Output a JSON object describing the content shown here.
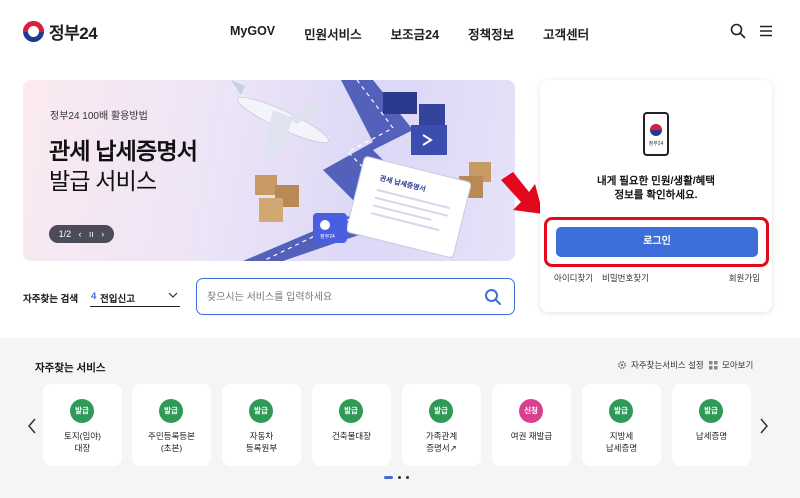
{
  "header": {
    "logo_text": "정부24",
    "nav": [
      "MyGOV",
      "민원서비스",
      "보조금24",
      "정책정보",
      "고객센터"
    ]
  },
  "banner": {
    "subtitle": "정부24 100배 활용방법",
    "title_line1": "관세 납세증명서",
    "title_line2": "발급 서비스",
    "page_indicator": "1/2",
    "prev_symbol": "‹",
    "pause_symbol": "ıı",
    "next_symbol": "›",
    "document_label": "관세 납세증명서",
    "badge_label": "정부24"
  },
  "login": {
    "phone_label": "정부24",
    "message_line1": "내게 필요한 민원/생활/혜택",
    "message_line2": "정보를 확인하세요.",
    "button_label": "로그인",
    "find_id": "아이디찾기",
    "find_password": "비밀번호찾기",
    "signup": "회원가입"
  },
  "search": {
    "fav_label": "자주찾는 검색",
    "fav_number": "4",
    "fav_value": "전입신고",
    "placeholder": "찾으시는 서비스를 입력하세요"
  },
  "services": {
    "title": "자주찾는 서비스",
    "settings_label": "자주찾는서비스 설정",
    "view_all_label": "모아보기",
    "items": [
      {
        "badge": "발급",
        "label": "토지(임야)\n대장"
      },
      {
        "badge": "발급",
        "label": "주민등록등본\n(초본)"
      },
      {
        "badge": "발급",
        "label": "자동차\n등록원부"
      },
      {
        "badge": "발급",
        "label": "건축물대장"
      },
      {
        "badge": "발급",
        "label": "가족관계\n증명서↗"
      },
      {
        "badge": "신청",
        "label": "여권 재발급"
      },
      {
        "badge": "발급",
        "label": "지방세\n납세증명"
      },
      {
        "badge": "발급",
        "label": "납세증명"
      }
    ]
  },
  "colors": {
    "primary": "#3e6fd8",
    "badge_issue": "#2e9a55",
    "badge_apply": "#d9408f",
    "highlight": "#e3081c"
  }
}
